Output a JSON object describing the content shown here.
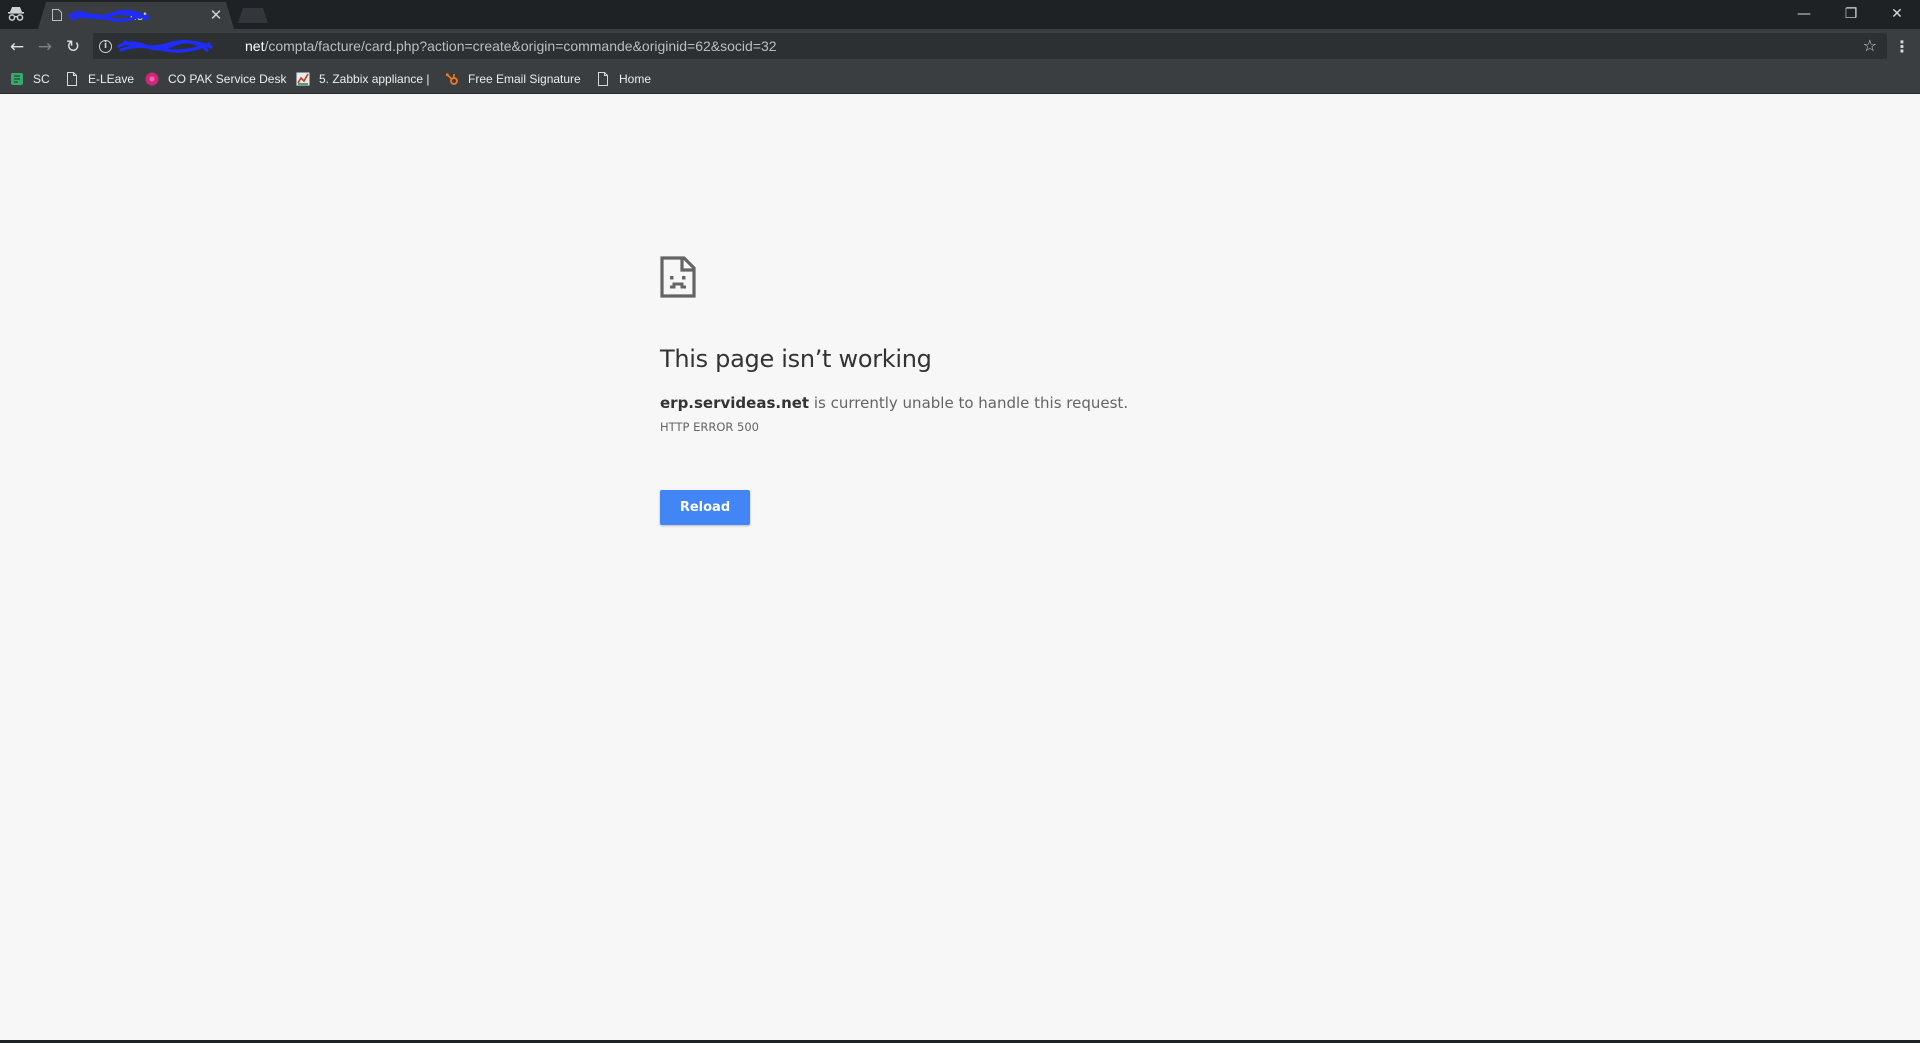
{
  "browser": {
    "tab": {
      "title": "net",
      "close_glyph": "✕"
    },
    "window_controls": {
      "minimize": "—",
      "restore": "❐",
      "close": "✕"
    },
    "toolbar": {
      "back_glyph": "←",
      "forward_glyph": "→",
      "reload_glyph": "↻",
      "info_glyph": "i",
      "url_host": "net",
      "url_path": "/compta/facture/card.php?action=create&origin=commande&originid=62&socid=32",
      "star_glyph": "☆",
      "menu_glyph": "⋮"
    },
    "bookmarks": [
      {
        "label": "SC",
        "icon": "sc-icon"
      },
      {
        "label": "E-LEave",
        "icon": "page-icon"
      },
      {
        "label": "CO PAK Service Desk",
        "icon": "service-desk-icon"
      },
      {
        "label": "5. Zabbix appliance |",
        "icon": "zabbix-icon"
      },
      {
        "label": "Free Email Signature",
        "icon": "hubspot-icon"
      },
      {
        "label": "Home",
        "icon": "page-icon"
      }
    ]
  },
  "error_page": {
    "title": "This page isn’t working",
    "host": "erp.servideas.net",
    "message_rest": " is currently unable to handle this request.",
    "code": "HTTP ERROR 500",
    "reload_label": "Reload",
    "icon": "sad-page-icon"
  },
  "colors": {
    "tab_strip": "#1f2224",
    "toolbar": "#3b3e41",
    "page_background": "#f7f7f7",
    "button_blue": "#4285f4",
    "redaction_blue": "#1f2cff"
  }
}
